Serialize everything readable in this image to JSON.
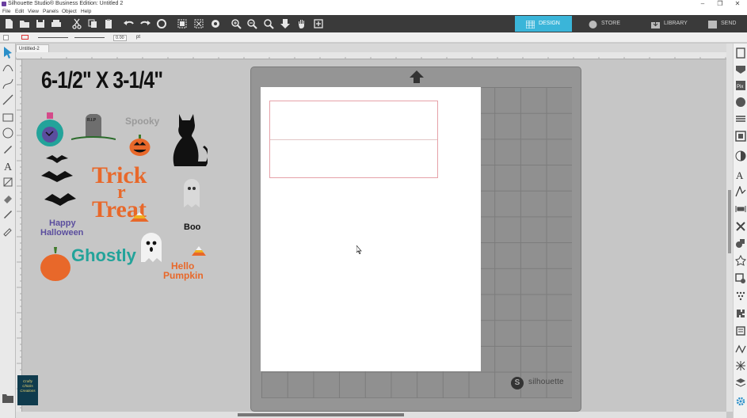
{
  "window": {
    "title": "Silhouette Studio® Business Edition: Untitled 2",
    "controls": [
      "–",
      "❐",
      "✕"
    ]
  },
  "menu": [
    "File",
    "Edit",
    "View",
    "Panels",
    "Object",
    "Help"
  ],
  "nav": {
    "design": "DESIGN",
    "store": "STORE",
    "library": "LIBRARY",
    "send": "SEND"
  },
  "propbar": {
    "line_width": "0.00",
    "unit": "pt"
  },
  "document": {
    "tab_label": "Untitled-2"
  },
  "canvas": {
    "size_label": "6-1/2\" X 3-1/4\"",
    "brand": "silhouette",
    "brand_logo": "S"
  },
  "designs": {
    "spooky": "Spooky",
    "trick": "Trick",
    "or": "r",
    "treat": "Treat",
    "happy": "Happy",
    "halloween": "Halloween",
    "boo": "Boo",
    "ghostly": "Ghostly",
    "hello": "Hello",
    "pumpkin": "Pumpkin",
    "tomb": "R.I.P"
  },
  "corner_logo": {
    "line1": "Crafty",
    "line2": "Chicks",
    "line3": "Creations"
  },
  "colors": {
    "accent": "#3ab5d9",
    "orange": "#e8682a",
    "teal": "#23a39a",
    "purple": "#5b4e9e"
  }
}
